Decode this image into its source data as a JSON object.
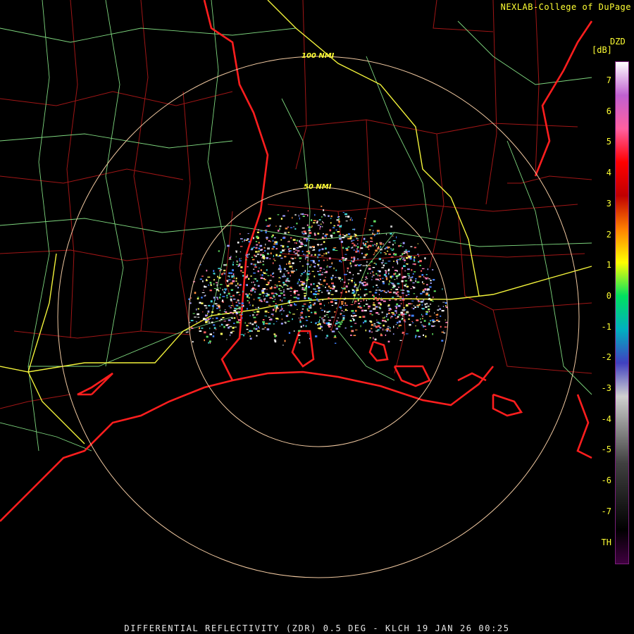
{
  "credit": "NEXLAB-College of DuPage",
  "colorbar": {
    "product": "DZD",
    "units": "[dB]",
    "ticks": [
      "7",
      "6",
      "5",
      "4",
      "3",
      "2",
      "1",
      "0",
      "-1",
      "-2",
      "-3",
      "-4",
      "-5",
      "-6",
      "-7",
      "TH"
    ],
    "stops": [
      "#ffffff",
      "#c060d0",
      "#ff60a0",
      "#ff0000",
      "#c00000",
      "#ff8000",
      "#ffff00",
      "#00e060",
      "#00b0c0",
      "#4040c0",
      "#d0d0d0",
      "#888888",
      "#404040",
      "#202020",
      "#000000",
      "#400040"
    ]
  },
  "range_rings": [
    "100 NMI",
    "50 NMI"
  ],
  "footer": "DIFFERENTIAL REFLECTIVITY (ZDR) 0.5 DEG - KLCH 19 JAN 26 00:25",
  "colors": {
    "coast": "#ff2020",
    "county": "#b01818",
    "highway": "#80e080",
    "interstate": "#ffff44",
    "ring": "#f0c8a0"
  }
}
